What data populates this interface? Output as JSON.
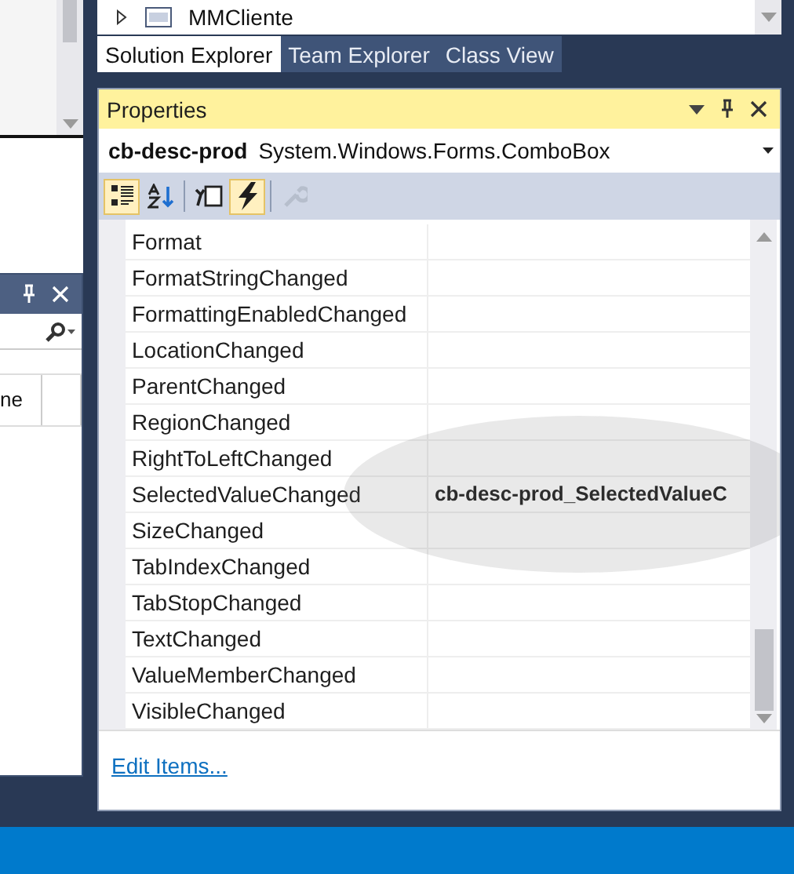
{
  "solution_explorer": {
    "tree_items": [
      {
        "label": "MMCliente",
        "expanded": false
      }
    ]
  },
  "tool_tabs": [
    {
      "label": "Solution Explorer",
      "selected": true
    },
    {
      "label": "Team Explorer",
      "selected": false
    },
    {
      "label": "Class View",
      "selected": false
    }
  ],
  "properties": {
    "title": "Properties",
    "object_name": "cb-desc-prod",
    "object_type": "System.Windows.Forms.ComboBox",
    "toolbar": [
      {
        "kind": "categorized",
        "selected": true,
        "disabled": false
      },
      {
        "kind": "alphabetical",
        "selected": false,
        "disabled": false
      },
      {
        "kind": "properties",
        "selected": false,
        "disabled": false
      },
      {
        "kind": "events",
        "selected": true,
        "disabled": false
      },
      {
        "kind": "property_pages",
        "selected": false,
        "disabled": true
      }
    ],
    "events": [
      {
        "name": "Format"
      },
      {
        "name": "FormatStringChanged"
      },
      {
        "name": "FormattingEnabledChanged"
      },
      {
        "name": "LocationChanged"
      },
      {
        "name": "ParentChanged"
      },
      {
        "name": "RegionChanged"
      },
      {
        "name": "RightToLeftChanged"
      },
      {
        "name": "SelectedValueChanged",
        "handler": "cb-desc-prod_SelectedValueC"
      },
      {
        "name": "SizeChanged"
      },
      {
        "name": "TabIndexChanged"
      },
      {
        "name": "TabStopChanged"
      },
      {
        "name": "TextChanged"
      },
      {
        "name": "ValueMemberChanged"
      },
      {
        "name": "VisibleChanged"
      }
    ],
    "link": "Edit Items..."
  },
  "left_panel": {
    "column_header": "ne"
  }
}
